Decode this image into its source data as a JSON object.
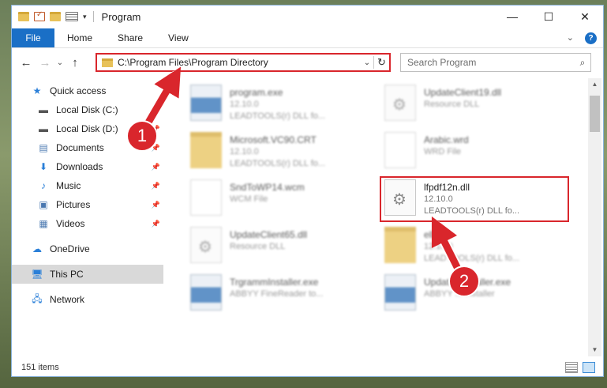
{
  "window": {
    "title": "Program",
    "controls": {
      "minimize": "—",
      "maximize": "☐",
      "close": "✕"
    }
  },
  "ribbon": {
    "tabs": [
      "File",
      "Home",
      "Share",
      "View"
    ],
    "expand_icon": "chevron-down-icon",
    "help_icon": "?"
  },
  "nav": {
    "back": "←",
    "forward": "→",
    "recent": "⌄",
    "up": "↑",
    "address": "C:\\Program Files\\Program Directory",
    "search_placeholder": "Search Program"
  },
  "sidebar": {
    "items": [
      {
        "label": "Quick access",
        "icon": "star-icon",
        "pinned": false
      },
      {
        "label": "Local Disk (C:)",
        "icon": "drive-icon",
        "pinned": true
      },
      {
        "label": "Local Disk (D:)",
        "icon": "drive-icon",
        "pinned": true
      },
      {
        "label": "Documents",
        "icon": "documents-icon",
        "pinned": true
      },
      {
        "label": "Downloads",
        "icon": "download-icon",
        "pinned": true
      },
      {
        "label": "Music",
        "icon": "music-icon",
        "pinned": true
      },
      {
        "label": "Pictures",
        "icon": "pictures-icon",
        "pinned": true
      },
      {
        "label": "Videos",
        "icon": "videos-icon",
        "pinned": true
      },
      {
        "label": "OneDrive",
        "icon": "cloud-icon",
        "pinned": false
      },
      {
        "label": "This PC",
        "icon": "computer-icon",
        "pinned": false,
        "selected": true
      },
      {
        "label": "Network",
        "icon": "network-icon",
        "pinned": false
      }
    ]
  },
  "files": [
    {
      "name": "program.exe",
      "line1": "12.10.0",
      "line2": "LEADTOOLS(r) DLL fo...",
      "type": "exe"
    },
    {
      "name": "UpdateClient19.dll",
      "line1": "Resource DLL",
      "line2": "",
      "type": "dll"
    },
    {
      "name": "Microsoft.VC90.CRT",
      "line1": "12.10.0",
      "line2": "LEADTOOLS(r) DLL fo...",
      "type": "folder-doc"
    },
    {
      "name": "Arabic.wrd",
      "line1": "WRD File",
      "line2": "",
      "type": "blank"
    },
    {
      "name": "SndToWP14.wcm",
      "line1": "WCM File",
      "line2": "",
      "type": "blank"
    },
    {
      "name": "lfpdf12n.dll",
      "line1": "12.10.0",
      "line2": "LEADTOOLS(r) DLL fo...",
      "type": "dll",
      "highlighted": true
    },
    {
      "name": "UpdateClient65.dll",
      "line1": "Resource DLL",
      "line2": "",
      "type": "dll"
    },
    {
      "name": "ell",
      "line1": "12.10.0",
      "line2": "LEADTOOLS(r) DLL fo...",
      "type": "folder-doc"
    },
    {
      "name": "TrgrammInstaller.exe",
      "line1": "ABBYY FineReader to...",
      "line2": "",
      "type": "exe"
    },
    {
      "name": "Updater Installer.exe",
      "line1": "ABBYY ... installer",
      "line2": "",
      "type": "exe"
    }
  ],
  "status": {
    "count": "151 items"
  },
  "annotations": {
    "step1": "1",
    "step2": "2"
  },
  "colors": {
    "accent": "#1a6fc6",
    "highlight": "#d9262c"
  }
}
